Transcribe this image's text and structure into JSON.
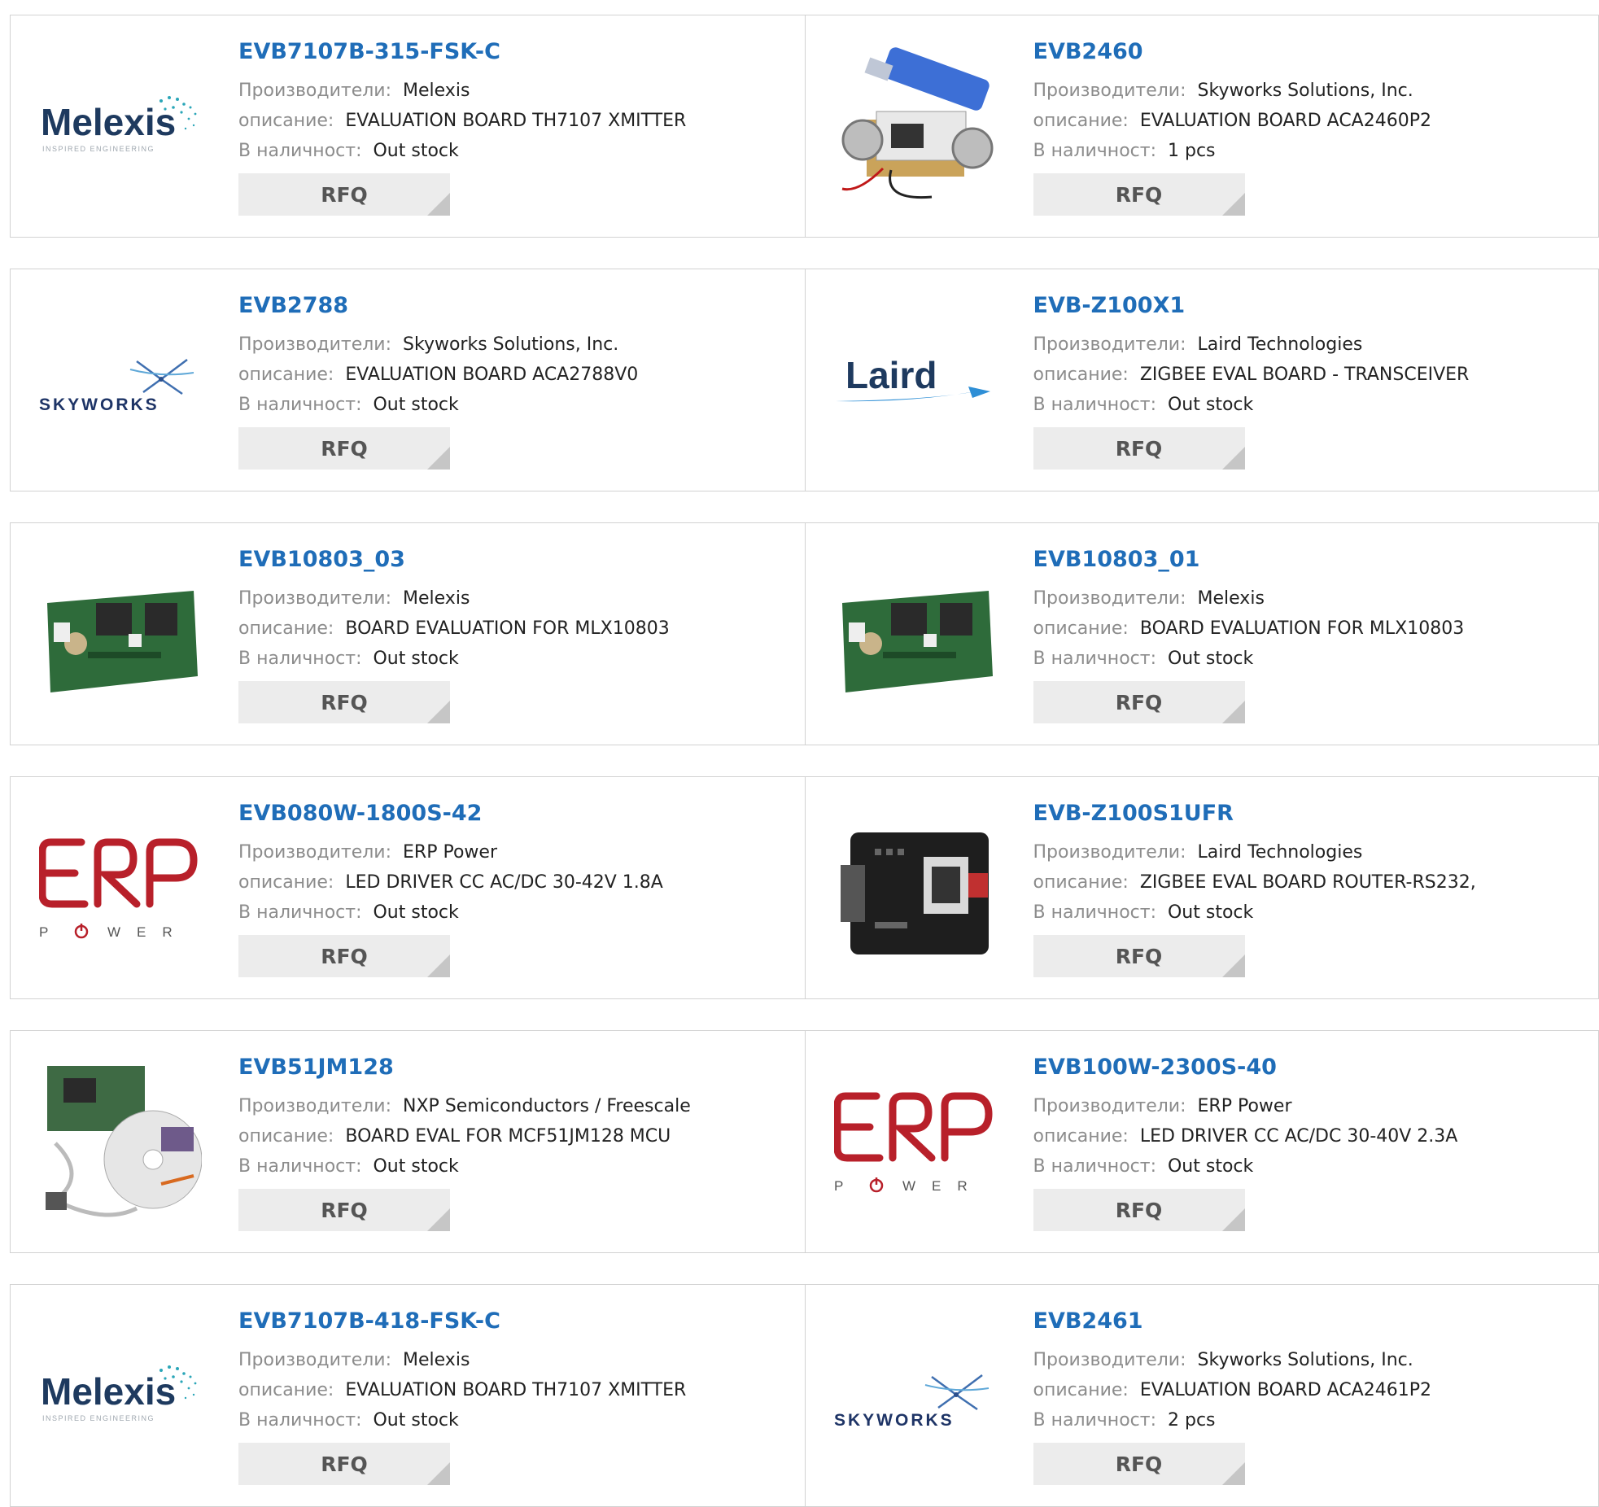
{
  "labels": {
    "manufacturer": "Производители:",
    "description": "описание:",
    "stock": "В наличност:",
    "rfq": "RFQ"
  },
  "products": [
    {
      "part": "EVB7107B-315-FSK-C",
      "manufacturer": "Melexis",
      "description": "EVALUATION BOARD TH7107 XMITTER",
      "stock": "Out stock",
      "image": "melexis-logo"
    },
    {
      "part": "EVB2460",
      "manufacturer": "Skyworks Solutions, Inc.",
      "description": "EVALUATION BOARD ACA2460P2",
      "stock": "1 pcs",
      "image": "board-photo-usb"
    },
    {
      "part": "EVB2788",
      "manufacturer": "Skyworks Solutions, Inc.",
      "description": "EVALUATION BOARD ACA2788V0",
      "stock": "Out stock",
      "image": "skyworks-logo"
    },
    {
      "part": "EVB-Z100X1",
      "manufacturer": "Laird Technologies",
      "description": "ZIGBEE EVAL BOARD - TRANSCEIVER",
      "stock": "Out stock",
      "image": "laird-logo"
    },
    {
      "part": "EVB10803_03",
      "manufacturer": "Melexis",
      "description": "BOARD EVALUATION FOR MLX10803",
      "stock": "Out stock",
      "image": "green-board-photo"
    },
    {
      "part": "EVB10803_01",
      "manufacturer": "Melexis",
      "description": "BOARD EVALUATION FOR MLX10803",
      "stock": "Out stock",
      "image": "green-board-photo"
    },
    {
      "part": "EVB080W-1800S-42",
      "manufacturer": "ERP Power",
      "description": "LED DRIVER CC AC/DC 30-42V 1.8A",
      "stock": "Out stock",
      "image": "erp-power-logo"
    },
    {
      "part": "EVB-Z100S1UFR",
      "manufacturer": "Laird Technologies",
      "description": "ZIGBEE EVAL BOARD ROUTER-RS232,",
      "stock": "Out stock",
      "image": "black-board-photo"
    },
    {
      "part": "EVB51JM128",
      "manufacturer": "NXP Semiconductors / Freescale",
      "description": "BOARD EVAL FOR MCF51JM128 MCU",
      "stock": "Out stock",
      "image": "kit-photo"
    },
    {
      "part": "EVB100W-2300S-40",
      "manufacturer": "ERP Power",
      "description": "LED DRIVER CC AC/DC 30-40V 2.3A",
      "stock": "Out stock",
      "image": "erp-power-logo"
    },
    {
      "part": "EVB7107B-418-FSK-C",
      "manufacturer": "Melexis",
      "description": "EVALUATION BOARD TH7107 XMITTER",
      "stock": "Out stock",
      "image": "melexis-logo"
    },
    {
      "part": "EVB2461",
      "manufacturer": "Skyworks Solutions, Inc.",
      "description": "EVALUATION BOARD ACA2461P2",
      "stock": "2 pcs",
      "image": "skyworks-logo"
    }
  ]
}
